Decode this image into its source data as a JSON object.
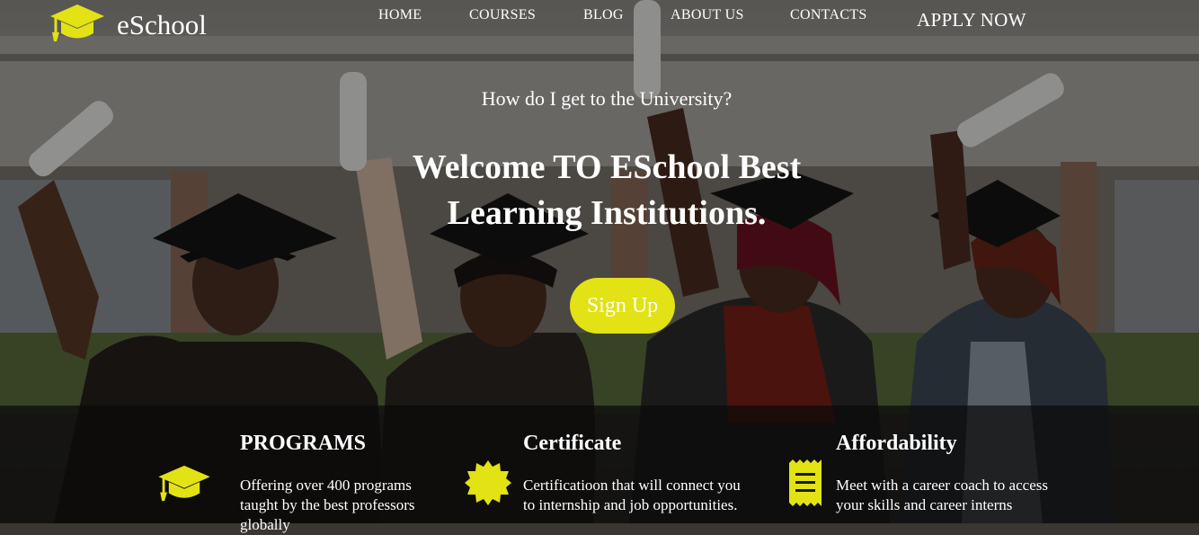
{
  "brand": {
    "name": "eSchool",
    "accent_color": "#e2e214",
    "logo_icon": "graduation-cap-icon"
  },
  "nav": {
    "items": [
      "HOME",
      "COURSES",
      "BLOG",
      "ABOUT US",
      "CONTACTS"
    ],
    "cta": "APPLY NOW"
  },
  "hero": {
    "kicker": "How do I get to the University?",
    "headline_line1": "Welcome TO ESchool Best",
    "headline_line2": "Learning Institutions.",
    "signup_label": "Sign Up"
  },
  "features": [
    {
      "icon": "graduation-cap-icon",
      "title": "PROGRAMS",
      "line1": "Offering over 400 programs",
      "line2": "taught by the best professors",
      "line3": "globally"
    },
    {
      "icon": "badge-seal-icon",
      "title": "Certificate",
      "line1": "Certificatioon that will connect you",
      "line2": "to internship and job opportunities."
    },
    {
      "icon": "receipt-icon",
      "title": "Affordability",
      "line1": "Meet with a career coach to access",
      "line2": "your skills and career interns"
    }
  ]
}
